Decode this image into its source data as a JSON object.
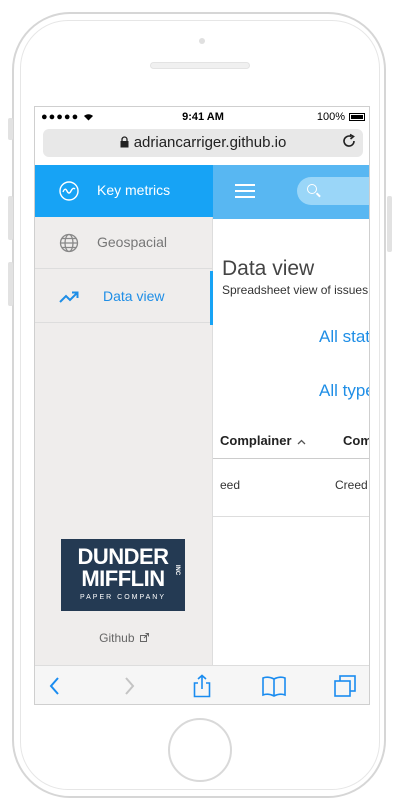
{
  "status_bar": {
    "signal": "●●●●● ",
    "time": "9:41 AM",
    "battery": "100%"
  },
  "browser": {
    "url": "adriancarriger.github.io"
  },
  "sidebar": {
    "items": [
      {
        "label": "Key metrics",
        "icon": "chart-wave-icon"
      },
      {
        "label": "Geospacial",
        "icon": "globe-icon"
      },
      {
        "label": "Data view",
        "icon": "trend-up-icon"
      }
    ],
    "logo": {
      "line1": "DUNDER",
      "line2": "MIFFLIN",
      "line3": "PAPER COMPANY",
      "badge": "INC"
    },
    "github_label": "Github"
  },
  "main": {
    "title": "Data view",
    "subtitle": "Spreadsheet view of issues",
    "filters": [
      "All status",
      "All types"
    ],
    "table": {
      "headers": [
        "Complainer",
        "Com"
      ],
      "rows": [
        [
          "eed",
          "Creed"
        ]
      ]
    }
  },
  "colors": {
    "accent": "#17a3f5",
    "topbar": "#58b7f2",
    "link": "#1f8ee6",
    "logo_bg": "#243a53"
  }
}
